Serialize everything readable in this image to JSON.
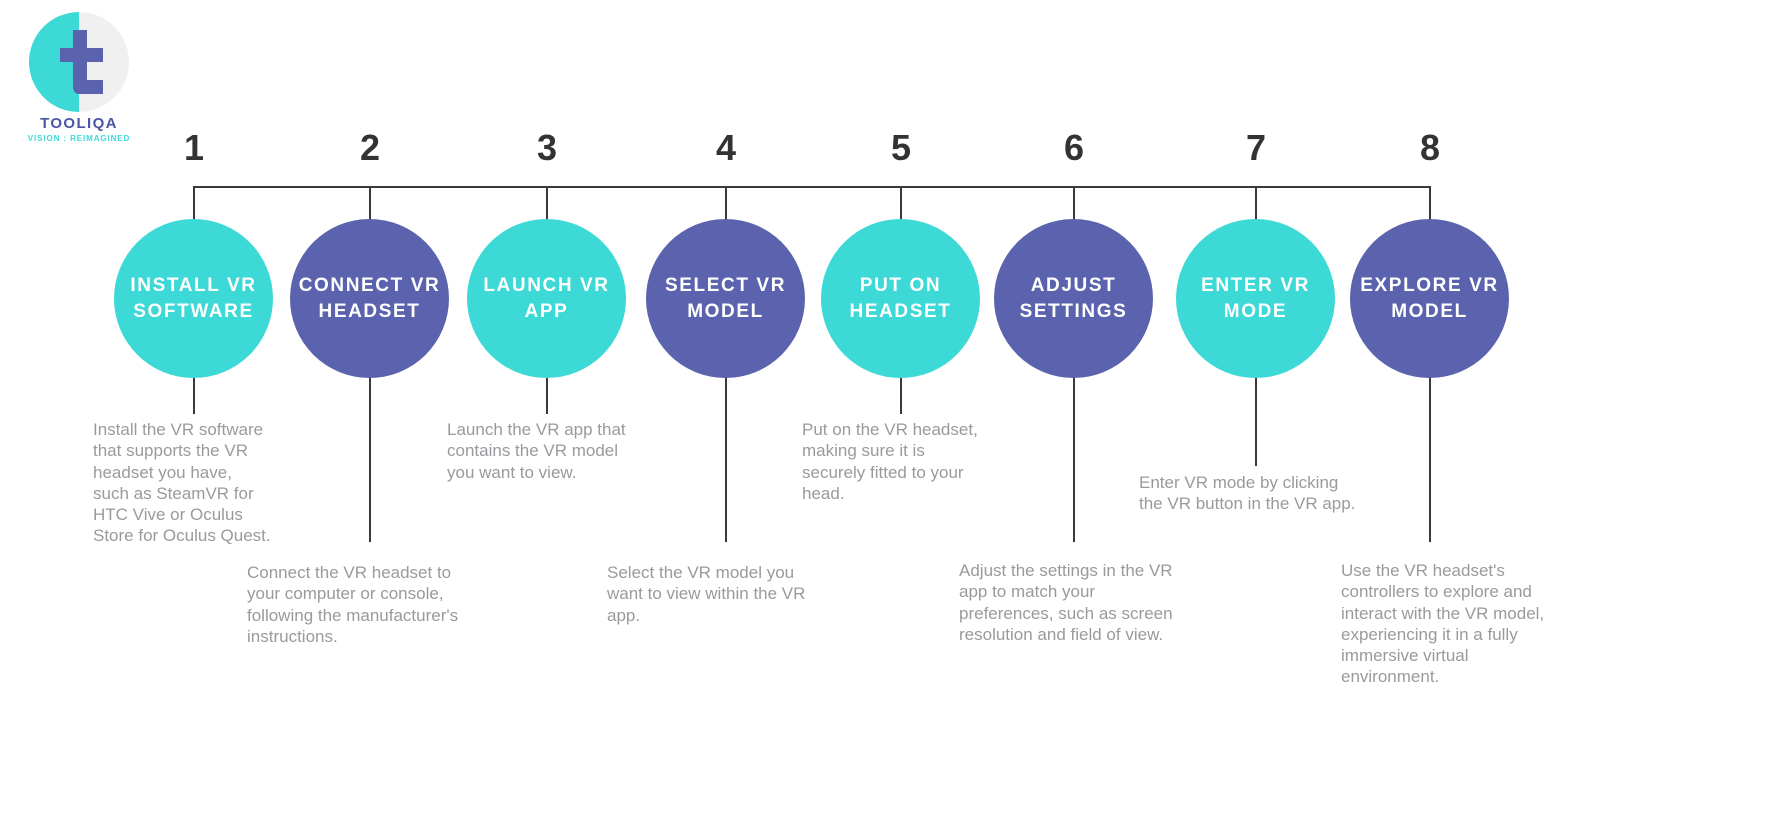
{
  "brand": {
    "name": "TOOLIQA",
    "tagline": "VISION : REIMAGINED",
    "mark_icon": "tooliqa-t-logo-icon",
    "teal": "#3DD9D6",
    "purple": "#5C63AE"
  },
  "theme": {
    "background": "#FFFFFF",
    "line_color": "#3A3A3A",
    "number_color": "#333333",
    "description_color": "#9A9A9E"
  },
  "steps": [
    {
      "number": "1",
      "label": "INSTALL VR\nSOFTWARE",
      "color": "#3DD9D6",
      "color_name": "teal",
      "description": "Install the VR software\nthat supports the VR\nheadset you have,\nsuch as SteamVR for\nHTC Vive or Oculus\nStore for Oculus Quest."
    },
    {
      "number": "2",
      "label": "CONNECT\nVR\nHEADSET",
      "color": "#5C63AE",
      "color_name": "purple",
      "description": "Connect the VR headset to\nyour computer or console,\nfollowing the manufacturer's\ninstructions."
    },
    {
      "number": "3",
      "label": "LAUNCH\nVR APP",
      "color": "#3DD9D6",
      "color_name": "teal",
      "description": "Launch the VR app that\ncontains the VR model\nyou want to view."
    },
    {
      "number": "4",
      "label": "SELECT VR\nMODEL",
      "color": "#5C63AE",
      "color_name": "purple",
      "description": "Select the VR model you\nwant to view within the VR\napp."
    },
    {
      "number": "5",
      "label": "PUT ON\nHEADSET",
      "color": "#3DD9D6",
      "color_name": "teal",
      "description": "Put on the VR headset,\nmaking sure it is\nsecurely fitted to your\nhead."
    },
    {
      "number": "6",
      "label": "ADJUST\nSETTINGS",
      "color": "#5C63AE",
      "color_name": "purple",
      "description": "Adjust the settings in the VR\napp to match your\npreferences, such as screen\nresolution and field of view."
    },
    {
      "number": "7",
      "label": "ENTER VR\nMODE",
      "color": "#3DD9D6",
      "color_name": "teal",
      "description": "Enter VR mode by clicking\nthe VR button in the VR app."
    },
    {
      "number": "8",
      "label": "EXPLORE\nVR MODEL",
      "color": "#5C63AE",
      "color_name": "purple",
      "description": "Use the VR headset's\ncontrollers to explore and\ninteract with the VR model,\nexperiencing it in a fully\nimmersive virtual\nenvironment."
    }
  ]
}
